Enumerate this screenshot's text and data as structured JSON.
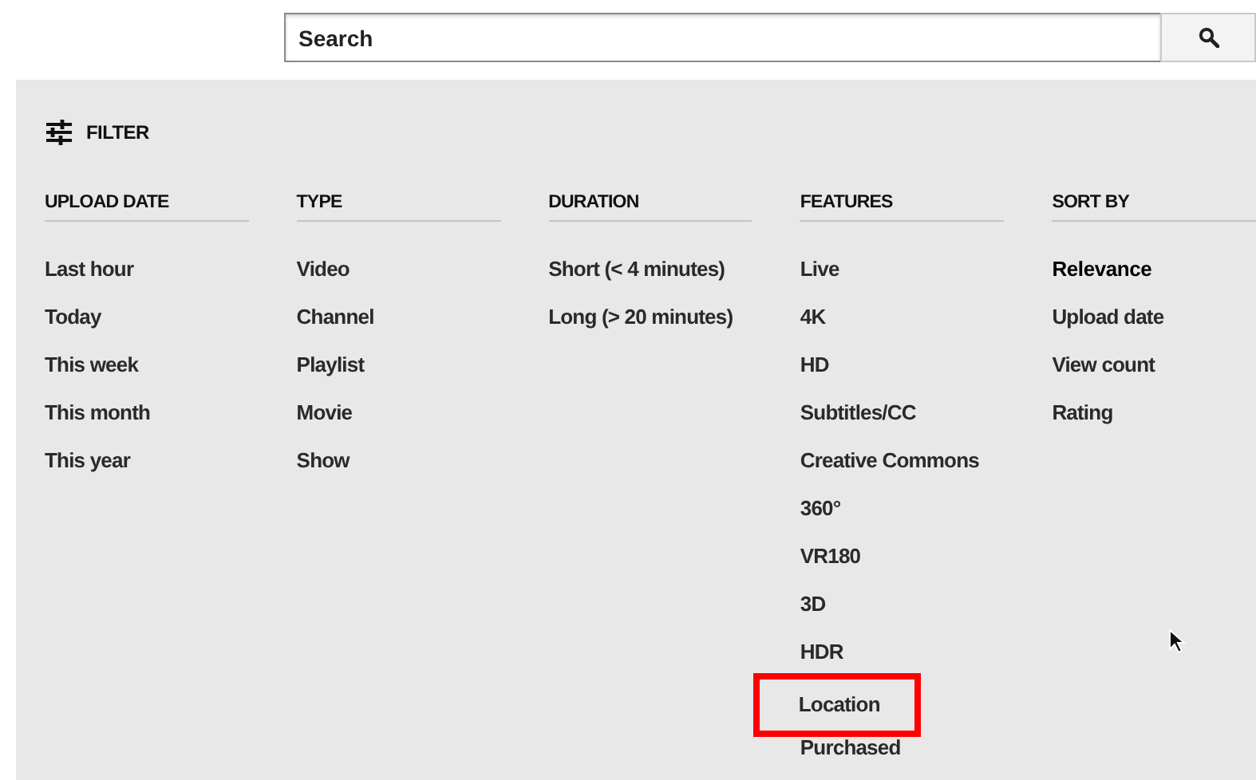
{
  "search": {
    "placeholder": "Search"
  },
  "filter": {
    "title": "FILTER",
    "columns": [
      {
        "heading": "UPLOAD DATE",
        "options": [
          {
            "label": "Last hour",
            "selected": false,
            "highlighted": false
          },
          {
            "label": "Today",
            "selected": false,
            "highlighted": false
          },
          {
            "label": "This week",
            "selected": false,
            "highlighted": false
          },
          {
            "label": "This month",
            "selected": false,
            "highlighted": false
          },
          {
            "label": "This year",
            "selected": false,
            "highlighted": false
          }
        ]
      },
      {
        "heading": "TYPE",
        "options": [
          {
            "label": "Video",
            "selected": false,
            "highlighted": false
          },
          {
            "label": "Channel",
            "selected": false,
            "highlighted": false
          },
          {
            "label": "Playlist",
            "selected": false,
            "highlighted": false
          },
          {
            "label": "Movie",
            "selected": false,
            "highlighted": false
          },
          {
            "label": "Show",
            "selected": false,
            "highlighted": false
          }
        ]
      },
      {
        "heading": "DURATION",
        "options": [
          {
            "label": "Short (< 4 minutes)",
            "selected": false,
            "highlighted": false
          },
          {
            "label": "Long (> 20 minutes)",
            "selected": false,
            "highlighted": false
          }
        ]
      },
      {
        "heading": "FEATURES",
        "options": [
          {
            "label": "Live",
            "selected": false,
            "highlighted": false
          },
          {
            "label": "4K",
            "selected": false,
            "highlighted": false
          },
          {
            "label": "HD",
            "selected": false,
            "highlighted": false
          },
          {
            "label": "Subtitles/CC",
            "selected": false,
            "highlighted": false
          },
          {
            "label": "Creative Commons",
            "selected": false,
            "highlighted": false
          },
          {
            "label": "360°",
            "selected": false,
            "highlighted": false
          },
          {
            "label": "VR180",
            "selected": false,
            "highlighted": false
          },
          {
            "label": "3D",
            "selected": false,
            "highlighted": false
          },
          {
            "label": "HDR",
            "selected": false,
            "highlighted": false
          },
          {
            "label": "Location",
            "selected": false,
            "highlighted": true
          },
          {
            "label": "Purchased",
            "selected": false,
            "highlighted": false
          }
        ]
      },
      {
        "heading": "SORT BY",
        "options": [
          {
            "label": "Relevance",
            "selected": true,
            "highlighted": false
          },
          {
            "label": "Upload date",
            "selected": false,
            "highlighted": false
          },
          {
            "label": "View count",
            "selected": false,
            "highlighted": false
          },
          {
            "label": "Rating",
            "selected": false,
            "highlighted": false
          }
        ]
      }
    ]
  }
}
